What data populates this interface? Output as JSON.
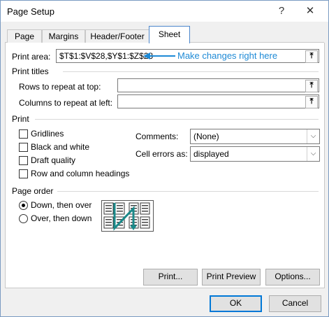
{
  "window": {
    "title": "Page Setup",
    "help_btn": "?",
    "close_btn": "✕"
  },
  "tabs": [
    {
      "label": "Page"
    },
    {
      "label": "Margins"
    },
    {
      "label": "Header/Footer"
    },
    {
      "label": "Sheet",
      "active": true
    }
  ],
  "print_area": {
    "label": "Print area:",
    "value": "$T$1:$V$28,$Y$1:$Z$28",
    "annotation": "Make changes right here"
  },
  "print_titles": {
    "heading": "Print titles",
    "rows_label": "Rows to repeat at top:",
    "rows_value": "",
    "cols_label": "Columns to repeat at left:",
    "cols_value": ""
  },
  "print": {
    "heading": "Print",
    "gridlines": {
      "label": "Gridlines",
      "checked": false
    },
    "black_white": {
      "label": "Black and white",
      "checked": false
    },
    "draft": {
      "label": "Draft quality",
      "checked": false
    },
    "row_col_headings": {
      "label": "Row and column headings",
      "checked": false
    },
    "comments_label": "Comments:",
    "comments_value": "(None)",
    "errors_label": "Cell errors as:",
    "errors_value": "displayed"
  },
  "page_order": {
    "heading": "Page order",
    "down_over": {
      "label": "Down, then over",
      "selected": true
    },
    "over_down": {
      "label": "Over, then down",
      "selected": false
    }
  },
  "buttons": {
    "print": "Print...",
    "print_preview": "Print Preview",
    "options": "Options...",
    "ok": "OK",
    "cancel": "Cancel"
  },
  "colors": {
    "accent": "#0078d7",
    "annotation": "#1e8ad6",
    "page_order_arrow": "#1a8a8a"
  },
  "icons": {
    "collapse": "collapse-dialog-icon",
    "dropdown": "chevron-down-icon",
    "annotation_arrow": "left-arrow-icon"
  }
}
